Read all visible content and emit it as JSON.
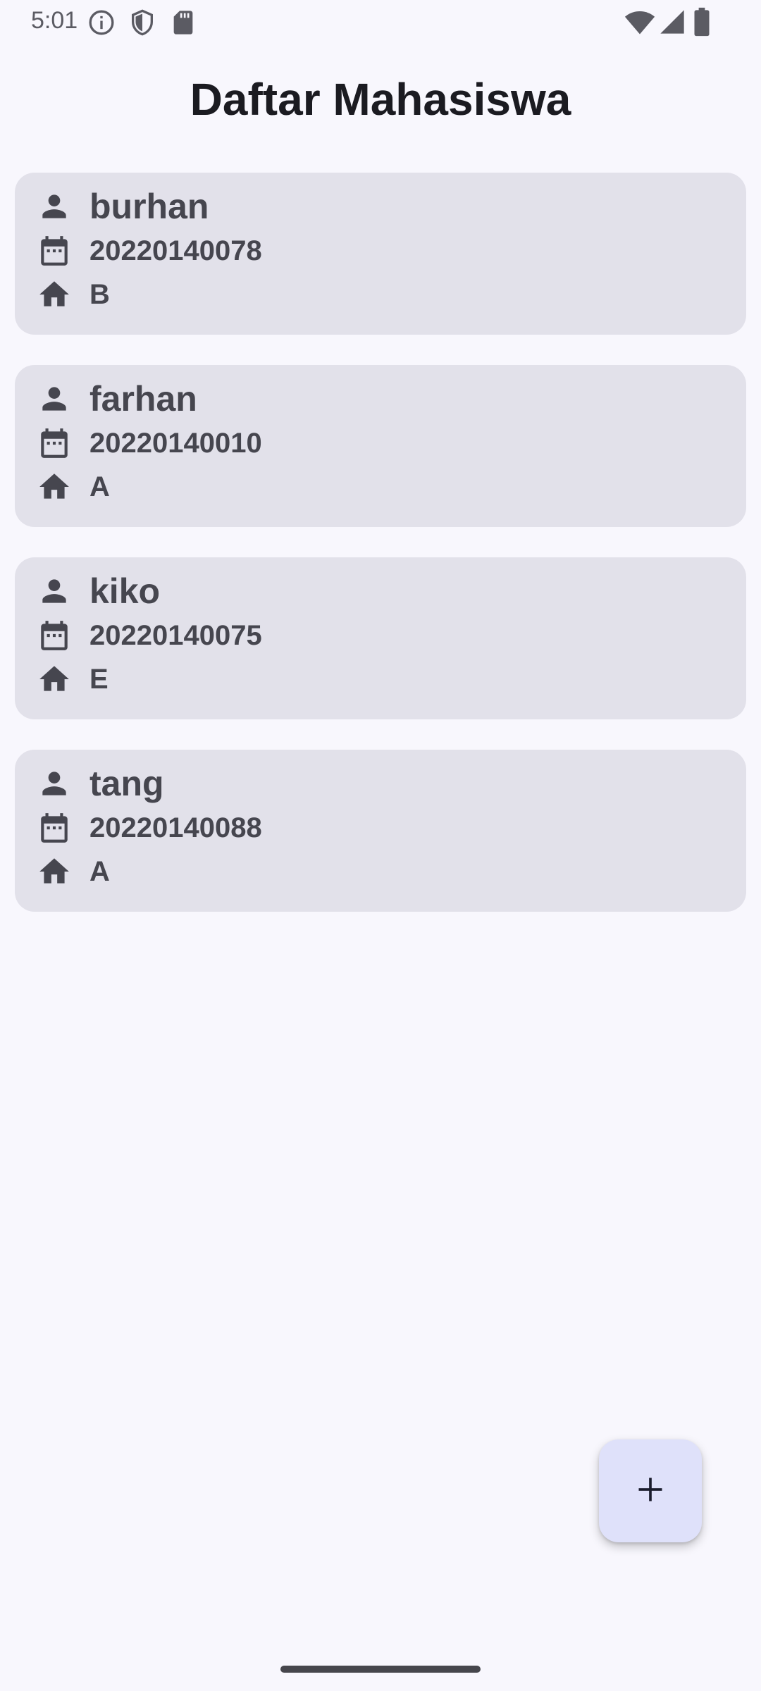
{
  "status_bar": {
    "time": "5:01",
    "icons_left": [
      "info-icon",
      "shield-icon",
      "sd-card-icon"
    ],
    "icons_right": [
      "wifi-icon",
      "signal-icon",
      "battery-icon"
    ]
  },
  "header": {
    "title": "Daftar Mahasiswa"
  },
  "students": [
    {
      "name": "burhan",
      "nim": "20220140078",
      "kelas": "B"
    },
    {
      "name": "farhan",
      "nim": "20220140010",
      "kelas": "A"
    },
    {
      "name": "kiko",
      "nim": "20220140075",
      "kelas": "E"
    },
    {
      "name": "tang",
      "nim": "20220140088",
      "kelas": "A"
    }
  ],
  "row_icons": {
    "name": "person-icon",
    "nim": "calendar-icon",
    "kelas": "home-icon"
  },
  "fab": {
    "icon": "plus-icon",
    "label": "+"
  },
  "colors": {
    "background": "#f8f7fd",
    "card": "#e2e1ea",
    "text": "#46464f",
    "title": "#1b1b21",
    "fab": "#dfe1fa"
  }
}
